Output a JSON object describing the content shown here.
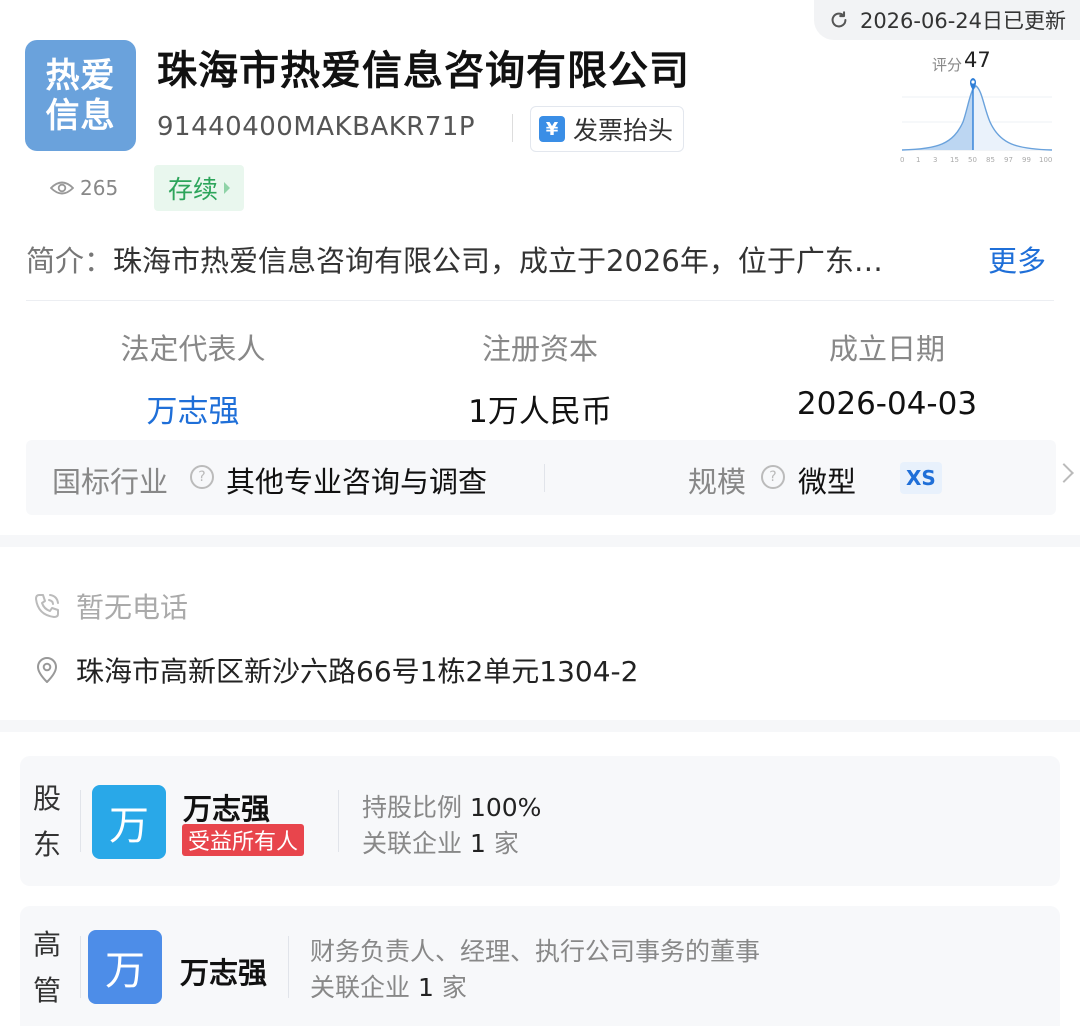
{
  "header": {
    "update_text": "2026-06-24日已更新",
    "logo_line1": "热爱",
    "logo_line2": "信息",
    "company_name": "珠海市热爱信息咨询有限公司",
    "credit_code": "91440400MAKBAKR71P",
    "invoice_icon": "¥",
    "invoice_label": "发票抬头",
    "views": "265",
    "status": "存续",
    "score_label": "评分",
    "score_value": "47",
    "score_ticks": [
      "0",
      "1",
      "3",
      "15",
      "50",
      "85",
      "97",
      "99",
      "100"
    ]
  },
  "intro": {
    "label": "简介：",
    "text": "珠海市热爱信息咨询有限公司，成立于2026年，位于广东…",
    "more": "更多"
  },
  "key_info": [
    {
      "label": "法定代表人",
      "value": "万志强"
    },
    {
      "label": "注册资本",
      "value": "1万人民币"
    },
    {
      "label": "成立日期",
      "value": "2026-04-03"
    }
  ],
  "industry": {
    "label": "国标行业",
    "value": "其他专业咨询与调查",
    "scale_label": "规模",
    "scale_value": "微型",
    "scale_badge": "XS"
  },
  "contact": {
    "phone": "暂无电话",
    "address": "珠海市高新区新沙六路66号1栋2单元1304-2"
  },
  "shareholder": {
    "title_1": "股",
    "title_2": "东",
    "avatar_char": "万",
    "name": "万志强",
    "badge": "受益所有人",
    "ratio_label": "持股比例",
    "ratio_value": "100%",
    "related_label": "关联企业",
    "related_count": "1",
    "related_unit": "家",
    "avatar_color": "#29a8e8"
  },
  "executive": {
    "title_1": "高",
    "title_2": "管",
    "avatar_char": "万",
    "name": "万志强",
    "roles": "财务负责人、经理、执行公司事务的董事",
    "related_label": "关联企业",
    "related_count": "1",
    "related_unit": "家",
    "avatar_color": "#4d8de8"
  },
  "colors": {
    "brand_blue": "#1f6fd8",
    "status_green": "#2da55b",
    "badge_red": "#e8454c",
    "logo_bg": "#6aa2dc"
  }
}
